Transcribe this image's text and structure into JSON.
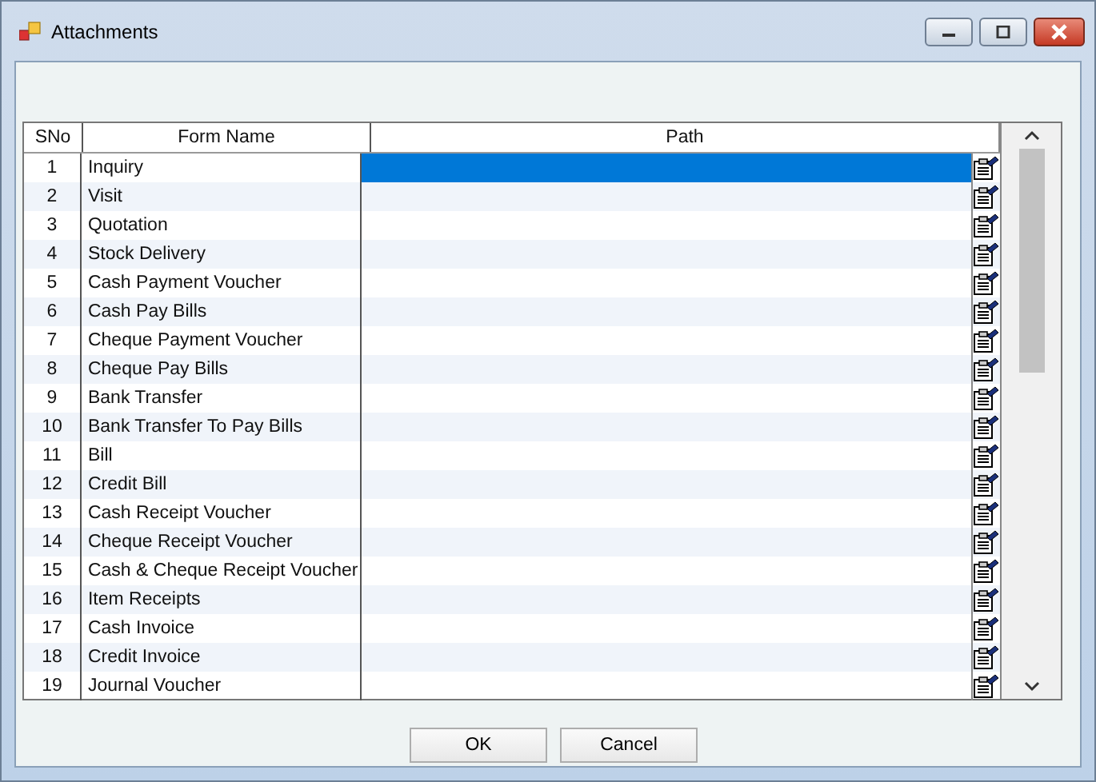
{
  "window": {
    "title": "Attachments"
  },
  "table": {
    "columns": [
      "SNo",
      "Form Name",
      "Path"
    ],
    "rows": [
      {
        "sno": "1",
        "form_name": "Inquiry",
        "selected": true
      },
      {
        "sno": "2",
        "form_name": "Visit",
        "selected": false
      },
      {
        "sno": "3",
        "form_name": "Quotation",
        "selected": false
      },
      {
        "sno": "4",
        "form_name": "Stock Delivery",
        "selected": false
      },
      {
        "sno": "5",
        "form_name": "Cash Payment Voucher",
        "selected": false
      },
      {
        "sno": "6",
        "form_name": "Cash Pay Bills",
        "selected": false
      },
      {
        "sno": "7",
        "form_name": "Cheque Payment Voucher",
        "selected": false
      },
      {
        "sno": "8",
        "form_name": "Cheque Pay Bills",
        "selected": false
      },
      {
        "sno": "9",
        "form_name": "Bank Transfer",
        "selected": false
      },
      {
        "sno": "10",
        "form_name": "Bank Transfer To Pay Bills",
        "selected": false
      },
      {
        "sno": "11",
        "form_name": "Bill",
        "selected": false
      },
      {
        "sno": "12",
        "form_name": "Credit Bill",
        "selected": false
      },
      {
        "sno": "13",
        "form_name": "Cash Receipt Voucher",
        "selected": false
      },
      {
        "sno": "14",
        "form_name": "Cheque Receipt Voucher",
        "selected": false
      },
      {
        "sno": "15",
        "form_name": "Cash & Cheque Receipt Voucher",
        "selected": false
      },
      {
        "sno": "16",
        "form_name": "Item Receipts",
        "selected": false
      },
      {
        "sno": "17",
        "form_name": "Cash Invoice",
        "selected": false
      },
      {
        "sno": "18",
        "form_name": "Credit Invoice",
        "selected": false
      },
      {
        "sno": "19",
        "form_name": "Journal Voucher",
        "selected": false
      }
    ]
  },
  "buttons": [
    "OK",
    "Cancel"
  ]
}
